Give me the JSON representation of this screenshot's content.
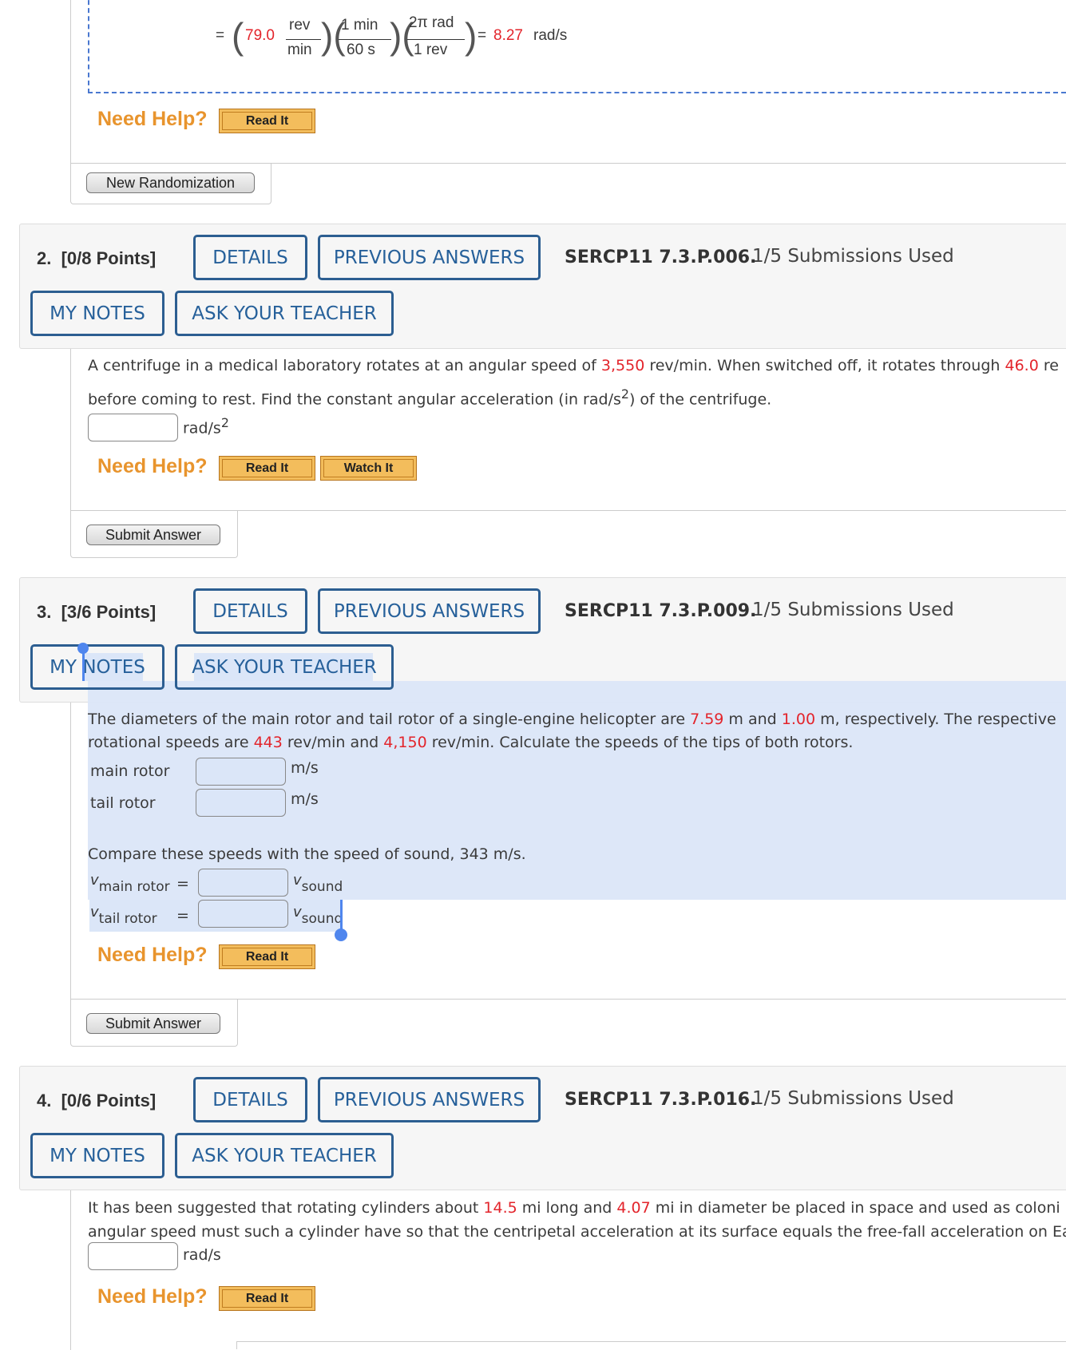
{
  "q1_tail": {
    "equals": "=",
    "value": "79.0",
    "rev": "rev",
    "min": "min",
    "min_top": "min",
    "one_min": "1 min",
    "sixty_s": "60 s",
    "two_pi_rad": "2π rad",
    "one_rev": "1 rev",
    "equals2": "=",
    "result": "8.27",
    "result_unit": "rad/s",
    "need_help": "Need Help?",
    "read_it": "Read It",
    "new_randomization": "New Randomization"
  },
  "questions": [
    {
      "number": "2.",
      "points": "[0/8 Points]",
      "details": "DETAILS",
      "previous_answers": "PREVIOUS ANSWERS",
      "code": "SERCP11 7.3.P.006.",
      "submissions": "1/5 Submissions Used",
      "my_notes": "MY NOTES",
      "ask_teacher": "ASK YOUR TEACHER",
      "text": {
        "l1a": "A centrifuge in a medical laboratory rotates at an angular speed of ",
        "v1": "3,550",
        "l1b": " rev/min. When switched off, it rotates through ",
        "v2": "46.0",
        "l1c": " re",
        "l2a": "before coming to rest. Find the constant angular acceleration (in rad/s",
        "sup": "2",
        "l2b": ") of the centrifuge."
      },
      "unit": "rad/s",
      "unit_sup": "2",
      "need_help": "Need Help?",
      "read_it": "Read It",
      "watch_it": "Watch It",
      "submit": "Submit Answer"
    },
    {
      "number": "3.",
      "points": "[3/6 Points]",
      "details": "DETAILS",
      "previous_answers": "PREVIOUS ANSWERS",
      "code": "SERCP11 7.3.P.009.",
      "submissions": "1/5 Submissions Used",
      "my_notes": "MY NOTES",
      "ask_teacher": "ASK YOUR TEACHER",
      "text": {
        "l1a": "The diameters of the main rotor and tail rotor of a single-engine helicopter are ",
        "v1": "7.59",
        "l1b": " m and ",
        "v2": "1.00",
        "l1c": " m, respectively. The respective",
        "l2a": "rotational speeds are ",
        "v3": "443",
        "l2b": " rev/min and ",
        "v4": "4,150",
        "l2c": " rev/min. Calculate the speeds of the tips of both rotors."
      },
      "main_rotor": "main rotor",
      "tail_rotor": "tail rotor",
      "unit": "m/s",
      "compare": "Compare these speeds with the speed of sound, 343 m/s.",
      "v": "v",
      "main_sub": "main rotor",
      "tail_sub": "tail rotor",
      "sound_sub": "sound",
      "eq": "=",
      "need_help": "Need Help?",
      "read_it": "Read It",
      "submit": "Submit Answer"
    },
    {
      "number": "4.",
      "points": "[0/6 Points]",
      "details": "DETAILS",
      "previous_answers": "PREVIOUS ANSWERS",
      "code": "SERCP11 7.3.P.016.",
      "submissions": "1/5 Submissions Used",
      "my_notes": "MY NOTES",
      "ask_teacher": "ASK YOUR TEACHER",
      "text": {
        "l1a": "It has been suggested that rotating cylinders about ",
        "v1": "14.5",
        "l1b": " mi long and ",
        "v2": "4.07",
        "l1c": " mi in diameter be placed in space and used as coloni",
        "l2a": "angular speed must such a cylinder have so that the centripetal acceleration at its surface equals the free-fall acceleration on Ea"
      },
      "unit": "rad/s",
      "need_help": "Need Help?",
      "read_it": "Read It"
    }
  ]
}
